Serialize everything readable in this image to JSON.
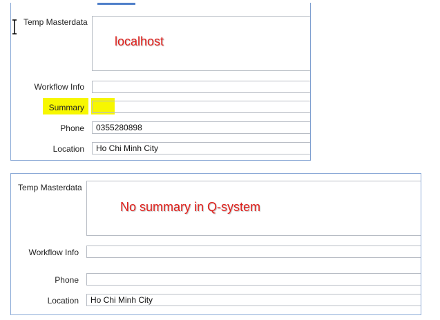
{
  "top_panel": {
    "temp_masterdata_label": "Temp Masterdata",
    "annotation": "localhost",
    "workflow_info_label": "Workflow Info",
    "summary_label": "Summary",
    "phone_label": "Phone",
    "phone_value": "0355280898",
    "location_label": "Location",
    "location_value": "Ho Chi Minh City",
    "highlight_color": "#f7f700"
  },
  "bottom_panel": {
    "temp_masterdata_label": "Temp Masterdata",
    "annotation": "No summary in Q-system",
    "workflow_info_label": "Workflow Info",
    "phone_label": "Phone",
    "location_label": "Location",
    "location_value": "Ho Chi Minh City"
  },
  "icons": {
    "cursor": "text-cursor-icon"
  },
  "colors": {
    "annotation_text": "#e0201c",
    "panel_border": "#8aa9d6"
  }
}
